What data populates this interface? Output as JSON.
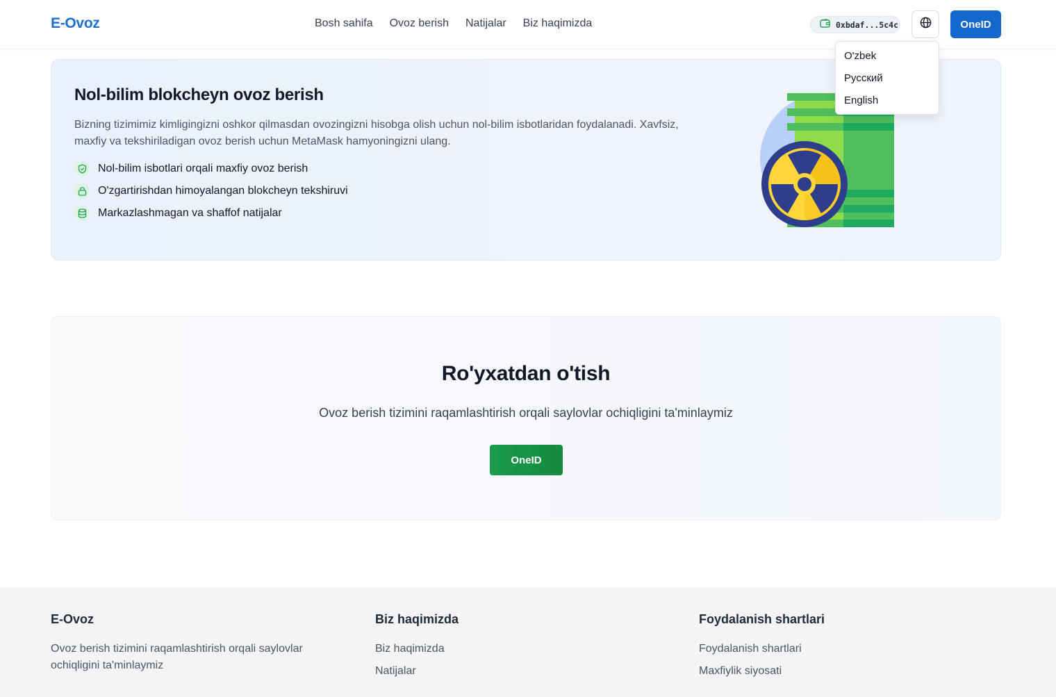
{
  "header": {
    "logo": "E-Ovoz",
    "nav": [
      "Bosh sahifa",
      "Ovoz berish",
      "Natijalar",
      "Biz haqimizda"
    ],
    "wallet_address": "0xbdaf...5c4c",
    "oneid_label": "OneID"
  },
  "language_menu": {
    "options": [
      "O'zbek",
      "Русский",
      "English"
    ]
  },
  "hero": {
    "title": "Nol-bilim blokcheyn ovoz berish",
    "description": "Bizning tizimimiz kimligingizni oshkor qilmasdan ovozingizni hisobga olish uchun nol-bilim isbotlaridan foydalanadi. Xavfsiz, maxfiy va tekshiriladigan ovoz berish uchun MetaMask hamyoningizni ulang.",
    "features": [
      {
        "icon": "shield-check-icon",
        "text": "Nol-bilim isbotlari orqali maxfiy ovoz berish"
      },
      {
        "icon": "lock-icon",
        "text": "O'zgartirishdan himoyalangan blokcheyn tekshiruvi"
      },
      {
        "icon": "database-icon",
        "text": "Markazlashmagan va shaffof natijalar"
      }
    ]
  },
  "register": {
    "title": "Ro'yxatdan o'tish",
    "subtitle": "Ovoz berish tizimini raqamlashtirish orqali saylovlar ochiqligini ta'minlaymiz",
    "button_label": "OneID"
  },
  "footer": {
    "brand": {
      "title": "E-Ovoz",
      "description": "Ovoz berish tizimini raqamlashtirish orqali saylovlar ochiqligini ta'minlaymiz"
    },
    "about": {
      "title": "Biz haqimizda",
      "links": [
        "Biz haqimizda",
        "Natijalar"
      ]
    },
    "terms": {
      "title": "Foydalanish shartlari",
      "links": [
        "Foydalanish shartlari",
        "Maxfiylik siyosati"
      ]
    }
  },
  "colors": {
    "brand_blue": "#1467cc",
    "accent_green": "#1a9b4b"
  }
}
